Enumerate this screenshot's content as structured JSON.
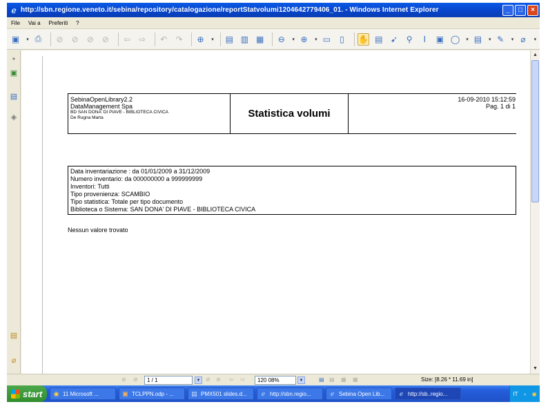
{
  "window": {
    "title": "http://sbn.regione.veneto.it/sebina/repository/catalogazione/reportStatvolumi1204642779406_01. - Windows Internet Explorer",
    "buttons": {
      "minimize": "_",
      "maximize": "□",
      "close": "×"
    }
  },
  "menu": [
    "File",
    "Vai a",
    "Preferiti",
    "?"
  ],
  "report": {
    "header_left": {
      "line1": "SebinaOpenLibrary2.2",
      "line2": "DataManagement Spa",
      "line3": "BD SAN DONA' DI PIAVE - BIBLIOTECA CIVICA",
      "line4": "De Rugna Marta"
    },
    "title": "Statistica volumi",
    "datetime": "16-09-2010 15:12:59",
    "page_label": "Pag. 1 di 1",
    "criteria": [
      "Data inventariazione : da  01/01/2009  a  31/12/2009",
      "Numero inventario: da  000000000  a   999999999",
      "Inventori: Tutti",
      "Tipo provenienza: SCAMBIO",
      "Tipo statistica: Totale per tipo documento",
      "Biblioteca o Sistema: SAN DONA' DI PIAVE - BIBLIOTECA CIVICA"
    ],
    "no_result": "Nessun valore trovato"
  },
  "navbar": {
    "page_value": "1 / 1",
    "zoom_value": "120 08%",
    "size_text": "Size: [8.26 * 11.69 in]"
  },
  "taskbar": {
    "start_label": "start",
    "tasks": [
      {
        "label": "11 Microsoft ...",
        "icon": "outlook-icon"
      },
      {
        "label": "TCLPPN.odp - ...",
        "icon": "impress-icon"
      },
      {
        "label": "PMX501 slides.d...",
        "icon": "word-icon"
      },
      {
        "label": "http://sbn.regio...",
        "icon": "ie-icon"
      },
      {
        "label": "Sebina Open Lib...",
        "icon": "ie-icon"
      },
      {
        "label": "http://sb..regio...",
        "icon": "ie-icon"
      }
    ],
    "tray": {
      "lang": "IT",
      "clock": ""
    }
  },
  "colors": {
    "titlebar": "#0743c8",
    "taskbar": "#245edb",
    "start": "#2f8d2d",
    "chrome": "#ece9d8"
  }
}
